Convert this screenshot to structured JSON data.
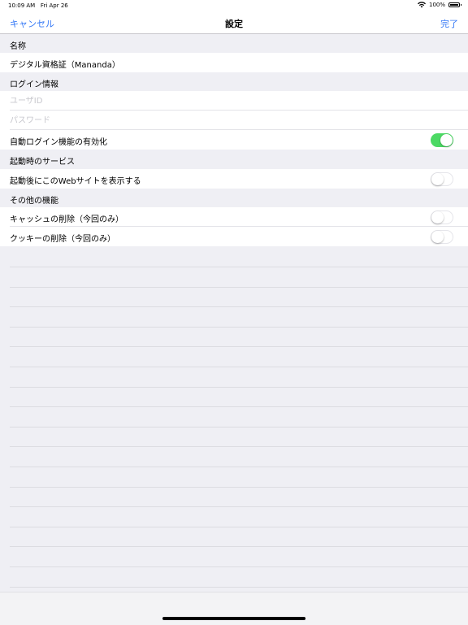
{
  "status_bar": {
    "time": "10:09 AM",
    "date": "Fri Apr 26",
    "battery": "100%",
    "battery_level": 1.0,
    "wifi_icon": "wifi-icon",
    "battery_icon": "battery-icon"
  },
  "nav": {
    "cancel_label": "キャンセル",
    "title": "設定",
    "done_label": "完了"
  },
  "sections": {
    "name": {
      "header": "名称",
      "value": "デジタル資格証（Mananda）"
    },
    "login": {
      "header": "ログイン情報",
      "userid_placeholder": "ユーザID",
      "password_placeholder": "パスワード",
      "auto_login_label": "自動ログイン機能の有効化",
      "auto_login_on": true
    },
    "startup": {
      "header": "起動時のサービス",
      "show_website_label": "起動後にこのWebサイトを表示する",
      "show_website_on": false
    },
    "other": {
      "header": "その他の機能",
      "clear_cache_label": "キャッシュの削除（今回のみ）",
      "clear_cache_on": false,
      "clear_cookie_label": "クッキーの削除（今回のみ）",
      "clear_cookie_on": false
    }
  },
  "colors": {
    "accent": "#3478f6",
    "toggle_on": "#4cd964",
    "background": "#efeff4"
  }
}
